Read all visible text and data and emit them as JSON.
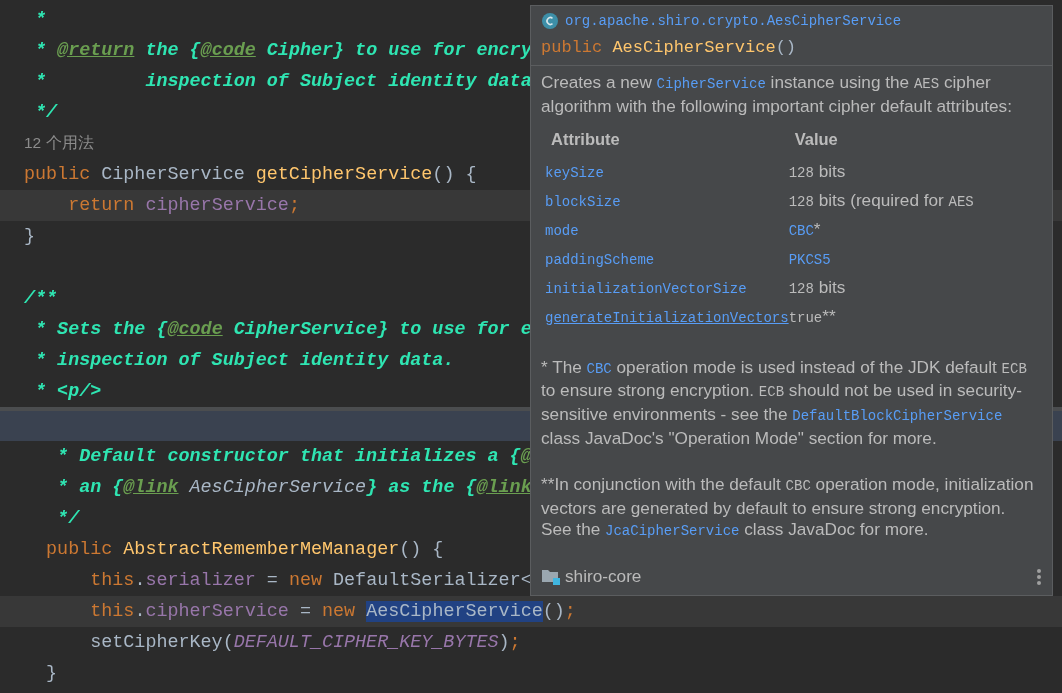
{
  "editor": {
    "top_lines": [
      {
        "kind": "code",
        "current": false,
        "tokens": [
          {
            "text": " *",
            "kind": "comment"
          }
        ]
      },
      {
        "kind": "code",
        "current": false,
        "tokens": [
          {
            "text": " * ",
            "kind": "comment"
          },
          {
            "text": "@return",
            "kind": "tag"
          },
          {
            "text": " the {",
            "kind": "comment"
          },
          {
            "text": "@code",
            "kind": "tag"
          },
          {
            "text": " Cipher} to use for encry",
            "kind": "comment"
          }
        ]
      },
      {
        "kind": "code",
        "current": false,
        "tokens": [
          {
            "text": " *         inspection of Subject identity data",
            "kind": "comment"
          }
        ]
      },
      {
        "kind": "code",
        "current": false,
        "tokens": [
          {
            "text": " */",
            "kind": "comment"
          }
        ]
      },
      {
        "kind": "hint",
        "text": "12 个用法"
      },
      {
        "kind": "code",
        "current": false,
        "tokens": [
          {
            "text": "public",
            "kind": "keyword"
          },
          {
            "text": " CipherService ",
            "kind": "plain"
          },
          {
            "text": "getCipherService",
            "kind": "method"
          },
          {
            "text": "() {",
            "kind": "plain"
          }
        ]
      },
      {
        "kind": "code",
        "current": true,
        "tokens": [
          {
            "text": "    return",
            "kind": "keyword"
          },
          {
            "text": " cipherService",
            "kind": "field"
          },
          {
            "text": ";",
            "kind": "keyword"
          }
        ]
      },
      {
        "kind": "code",
        "current": false,
        "tokens": [
          {
            "text": "}",
            "kind": "plain"
          }
        ]
      },
      {
        "kind": "blank"
      },
      {
        "kind": "code",
        "current": false,
        "tokens": [
          {
            "text": "/**",
            "kind": "comment"
          }
        ]
      },
      {
        "kind": "code",
        "current": false,
        "tokens": [
          {
            "text": " * Sets the {",
            "kind": "comment"
          },
          {
            "text": "@code",
            "kind": "tag"
          },
          {
            "text": " CipherService} to use for e",
            "kind": "comment"
          }
        ]
      },
      {
        "kind": "code",
        "current": false,
        "tokens": [
          {
            "text": " * inspection of Subject identity data.",
            "kind": "comment"
          }
        ]
      },
      {
        "kind": "code",
        "current": false,
        "tokens": [
          {
            "text": " * <p/>",
            "kind": "comment"
          }
        ]
      }
    ],
    "bottom_lines": [
      {
        "kind": "code",
        "current": false,
        "tokens": [
          {
            "text": "   * Default constructor that initializes a {",
            "kind": "comment"
          },
          {
            "text": "@",
            "kind": "tag"
          }
        ]
      },
      {
        "kind": "code",
        "current": false,
        "tokens": [
          {
            "text": "   * an {",
            "kind": "comment"
          },
          {
            "text": "@link",
            "kind": "tag"
          },
          {
            "text": " AesCipherService",
            "kind": "doc_ref"
          },
          {
            "text": "} as the {",
            "kind": "comment"
          },
          {
            "text": "@link",
            "kind": "tag"
          }
        ]
      },
      {
        "kind": "code",
        "current": false,
        "tokens": [
          {
            "text": "   */",
            "kind": "comment"
          }
        ]
      },
      {
        "kind": "code",
        "current": false,
        "tokens": [
          {
            "text": "  public",
            "kind": "keyword"
          },
          {
            "text": " AbstractRememberMeManager",
            "kind": "method"
          },
          {
            "text": "() {",
            "kind": "plain"
          }
        ]
      },
      {
        "kind": "code",
        "current": false,
        "tokens": [
          {
            "text": "      this",
            "kind": "keyword"
          },
          {
            "text": ".",
            "kind": "plain"
          },
          {
            "text": "serializer",
            "kind": "field"
          },
          {
            "text": " = ",
            "kind": "plain"
          },
          {
            "text": "new",
            "kind": "keyword"
          },
          {
            "text": " DefaultSerializer<",
            "kind": "plain"
          }
        ]
      },
      {
        "kind": "code",
        "current": true,
        "tokens": [
          {
            "text": "      this",
            "kind": "keyword"
          },
          {
            "text": ".",
            "kind": "plain"
          },
          {
            "text": "cipherService",
            "kind": "field"
          },
          {
            "text": " = ",
            "kind": "plain"
          },
          {
            "text": "new ",
            "kind": "keyword"
          },
          {
            "text": "AesCipherService",
            "kind": "selected"
          },
          {
            "text": "()",
            "kind": "plain"
          },
          {
            "text": ";",
            "kind": "keyword"
          }
        ]
      },
      {
        "kind": "code",
        "current": false,
        "tokens": [
          {
            "text": "      setCipherKey(",
            "kind": "plain"
          },
          {
            "text": "DEFAULT_CIPHER_KEY_BYTES",
            "kind": "constant"
          },
          {
            "text": ")",
            "kind": "plain"
          },
          {
            "text": ";",
            "kind": "keyword"
          }
        ]
      },
      {
        "kind": "code",
        "current": false,
        "tokens": [
          {
            "text": "  }",
            "kind": "plain"
          }
        ]
      }
    ]
  },
  "popup": {
    "package": "org.apache.shiro.crypto.AesCipherService",
    "signature": [
      {
        "text": "public",
        "kind": "keyword"
      },
      {
        "text": " AesCipherService",
        "kind": "method"
      },
      {
        "text": "()",
        "kind": "plain"
      }
    ],
    "description": [
      {
        "text": "Creates a new ",
        "kind": "text"
      },
      {
        "text": "CipherService",
        "kind": "link"
      },
      {
        "text": " instance using the ",
        "kind": "text"
      },
      {
        "text": "AES",
        "kind": "code"
      },
      {
        "text": " cipher algorithm with the following important cipher default attributes:",
        "kind": "text"
      }
    ],
    "table": {
      "columns": [
        "Attribute",
        "Value"
      ],
      "rows": [
        {
          "attribute": "keySize",
          "hovered": false,
          "value": [
            {
              "text": "128",
              "kind": "code"
            },
            {
              "text": " bits",
              "kind": "text"
            }
          ]
        },
        {
          "attribute": "blockSize",
          "hovered": false,
          "value": [
            {
              "text": "128",
              "kind": "code"
            },
            {
              "text": " bits (required for ",
              "kind": "text"
            },
            {
              "text": "AES",
              "kind": "code"
            }
          ]
        },
        {
          "attribute": "mode",
          "hovered": false,
          "value": [
            {
              "text": "CBC",
              "kind": "link"
            },
            {
              "text": "*",
              "kind": "text"
            }
          ]
        },
        {
          "attribute": "paddingScheme",
          "hovered": false,
          "value": [
            {
              "text": "PKCS5",
              "kind": "link"
            }
          ]
        },
        {
          "attribute": "initializationVectorSize",
          "hovered": false,
          "value": [
            {
              "text": "128",
              "kind": "code"
            },
            {
              "text": " bits",
              "kind": "text"
            }
          ]
        },
        {
          "attribute": "generateInitializationVectors",
          "hovered": true,
          "value": [
            {
              "text": "true",
              "kind": "code"
            },
            {
              "text": "**",
              "kind": "text"
            }
          ]
        }
      ]
    },
    "notes": [
      [
        {
          "text": "* The ",
          "kind": "text"
        },
        {
          "text": "CBC",
          "kind": "link"
        },
        {
          "text": " operation mode is used instead of the JDK default ",
          "kind": "text"
        },
        {
          "text": "ECB",
          "kind": "code"
        },
        {
          "text": " to ensure strong encryption. ",
          "kind": "text"
        },
        {
          "text": "ECB",
          "kind": "code"
        },
        {
          "text": " should not be used in security-sensitive environments - see the ",
          "kind": "text"
        },
        {
          "text": "DefaultBlockCipherService",
          "kind": "link"
        },
        {
          "text": " class JavaDoc's \"Operation Mode\" section for more.",
          "kind": "text"
        }
      ],
      [
        {
          "text": "**In conjunction with the default ",
          "kind": "text"
        },
        {
          "text": "CBC",
          "kind": "code"
        },
        {
          "text": " operation mode, initialization vectors are generated by default to ensure strong encryption. See the ",
          "kind": "text"
        },
        {
          "text": "JcaCipherService",
          "kind": "link"
        },
        {
          "text": " class JavaDoc for more.",
          "kind": "text"
        }
      ]
    ],
    "module": "shiro-core"
  }
}
